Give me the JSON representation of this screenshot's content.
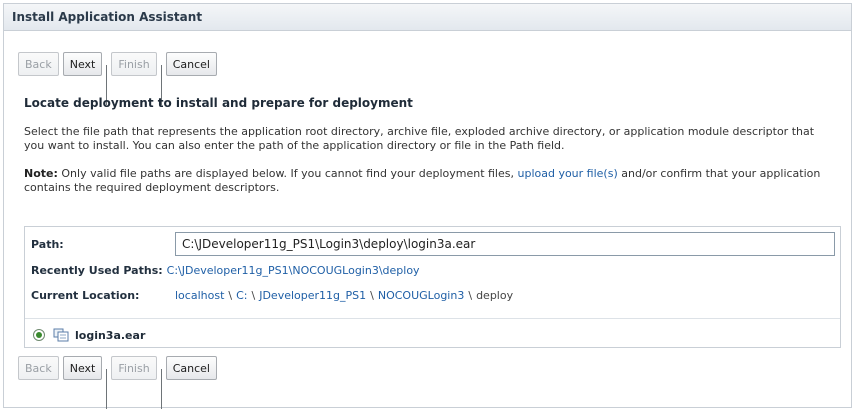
{
  "window": {
    "title": "Install Application Assistant"
  },
  "toolbar": {
    "back_label": "Back",
    "next_label": "Next",
    "finish_label": "Finish",
    "cancel_label": "Cancel"
  },
  "main": {
    "heading": "Locate deployment to install and prepare for deployment",
    "description": "Select the file path that represents the application root directory, archive file, exploded archive directory, or application module descriptor that you want to install. You can also enter the path of the application directory or file in the Path field.",
    "note_label": "Note:",
    "note_text_before": " Only valid file paths are displayed below. If you cannot find your deployment files, ",
    "note_link": "upload your file(s)",
    "note_text_after": " and/or confirm that your application contains the required deployment descriptors."
  },
  "path_panel": {
    "path_label": "Path:",
    "path_value": "C:\\JDeveloper11g_PS1\\Login3\\deploy\\login3a.ear",
    "recent_label": "Recently Used Paths:",
    "recent_path": "C:\\JDeveloper11g_PS1\\NOCOUGLogin3\\deploy",
    "current_label": "Current Location:",
    "breadcrumb": [
      "localhost",
      "C:",
      "JDeveloper11g_PS1",
      "NOCOUGLogin3",
      "deploy"
    ],
    "breadcrumb_separator": "\\"
  },
  "files": [
    {
      "name": "login3a.ear",
      "selected": true,
      "icon": "ear-archive-icon"
    }
  ],
  "colors": {
    "link": "#1f5fa6",
    "title_bar": "#e3e8ee",
    "radio_selected": "#3a8a2e"
  }
}
